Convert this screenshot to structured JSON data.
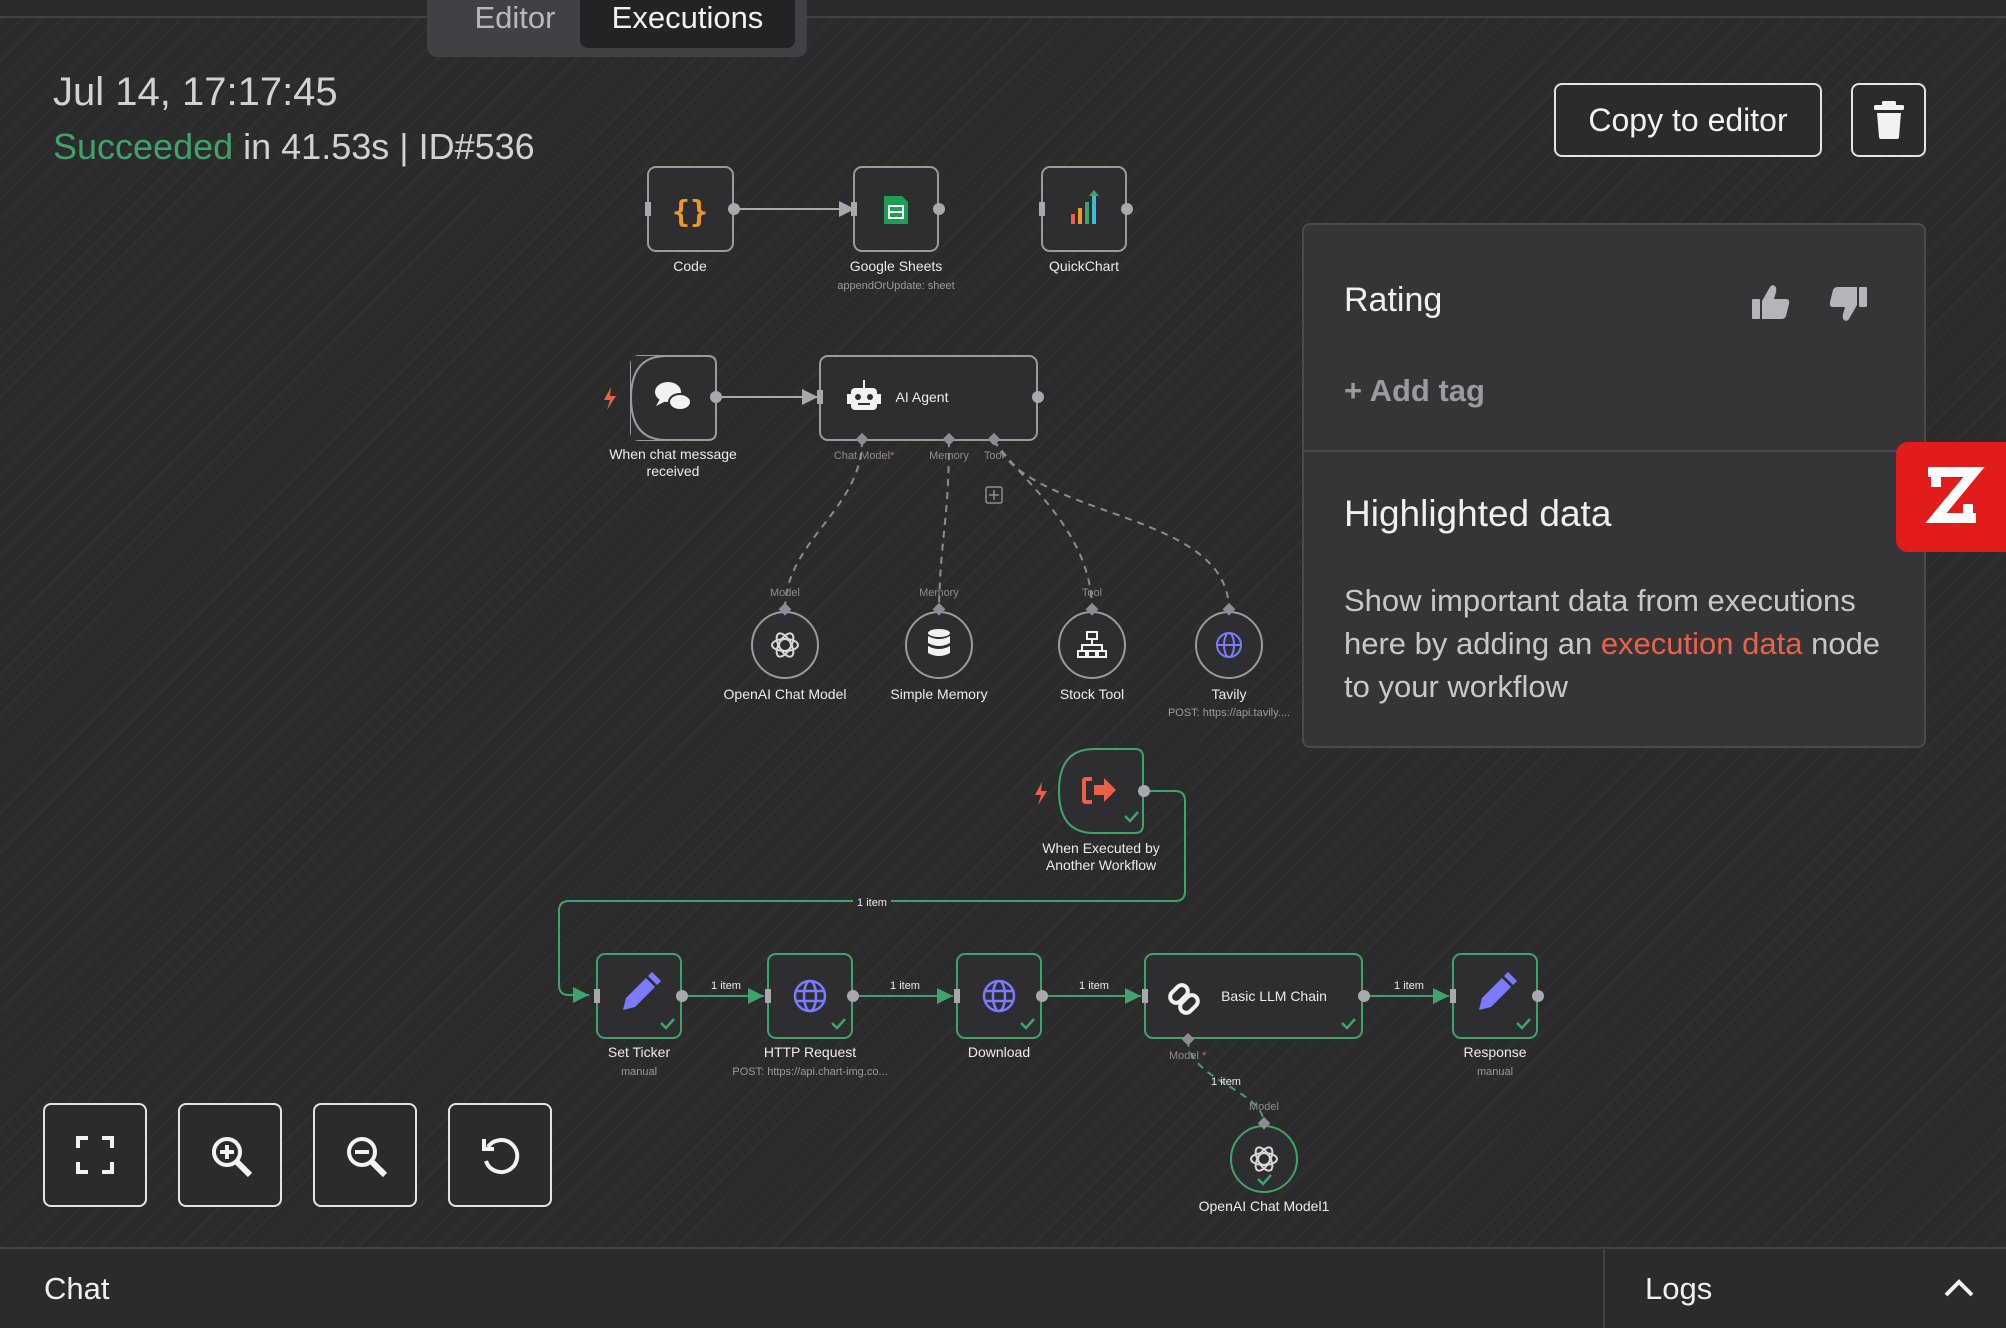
{
  "tabs": {
    "editor": "Editor",
    "executions": "Executions"
  },
  "execution": {
    "date": "Jul 14, 17:17:45",
    "status": "Succeeded",
    "duration": " in 41.53s | ID#536",
    "status_color": "#3fa46a"
  },
  "actions": {
    "copy_to_editor": "Copy to editor",
    "delete_icon": "trash-icon"
  },
  "panel": {
    "rating_title": "Rating",
    "add_tag": "+ Add tag",
    "highlighted_title": "Highlighted data",
    "highlighted_desc_before": "Show important data from executions here by adding an ",
    "highlighted_link": "execution data",
    "highlighted_desc_after": " node to your workflow",
    "link_color": "#e9614b"
  },
  "nodes": {
    "code": {
      "label": "Code"
    },
    "sheets": {
      "label": "Google Sheets",
      "sub": "appendOrUpdate: sheet"
    },
    "quickchart": {
      "label": "QuickChart"
    },
    "chat_trigger": {
      "label1": "When chat message",
      "label2": "received"
    },
    "agent": {
      "label": "AI Agent",
      "h_chat": "Chat Model",
      "h_mem": "Memory",
      "h_tool": "Tool"
    },
    "openai": {
      "label": "OpenAI Chat Model",
      "handle": "Model"
    },
    "memory": {
      "label": "Simple Memory",
      "handle": "Memory"
    },
    "stock": {
      "label": "Stock Tool",
      "handle": "Tool"
    },
    "tavily": {
      "label": "Tavily",
      "sub": "POST: https://api.tavily...."
    },
    "exec_trigger": {
      "label1": "When Executed by",
      "label2": "Another Workflow"
    },
    "set_ticker": {
      "label": "Set Ticker",
      "sub": "manual"
    },
    "http": {
      "label": "HTTP Request",
      "sub": "POST: https://api.chart-img.co..."
    },
    "download": {
      "label": "Download"
    },
    "llm_chain": {
      "label": "Basic LLM Chain",
      "handle": "Model"
    },
    "response": {
      "label": "Response",
      "sub": "manual"
    },
    "openai1": {
      "label": "OpenAI Chat Model1",
      "handle": "Model"
    }
  },
  "edges": {
    "item": "1 item"
  },
  "bottom": {
    "chat": "Chat",
    "logs": "Logs"
  },
  "colors": {
    "accent_success": "#3fa46a",
    "brand_badge": "#e21b1b",
    "node_icon_purple": "#7a7bff"
  }
}
